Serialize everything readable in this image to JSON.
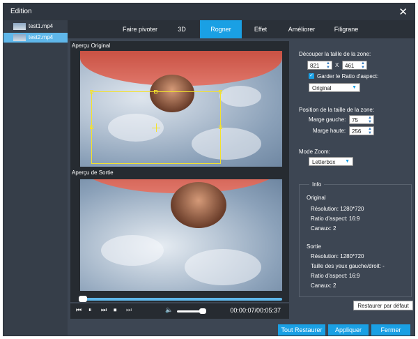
{
  "window": {
    "title": "Edition",
    "close_symbol": "✕"
  },
  "files": [
    {
      "name": "test1.mp4",
      "active": false
    },
    {
      "name": "test2.mp4",
      "active": true
    }
  ],
  "tabs": [
    "Faire pivoter",
    "3D",
    "Rogner",
    "Effet",
    "Améliorer",
    "Filigrane"
  ],
  "active_tab": "Rogner",
  "preview": {
    "original_label": "Aperçu Original",
    "output_label": "Aperçu de Sortie"
  },
  "playback": {
    "time": "00:00:07/00:05:37",
    "progress": 0.02,
    "volume": 0.8
  },
  "crop": {
    "section_label": "Découper la taille de la zone:",
    "width": "821",
    "separator": "X",
    "height": "461",
    "keep_ratio_label": "Garder le Ratio d'aspect:",
    "keep_ratio_checked": true,
    "ratio_value": "Original",
    "position_label": "Position de la taille de la zone:",
    "left_margin_label": "Marge gauche:",
    "left_margin": "75",
    "top_margin_label": "Marge haute:",
    "top_margin": "256",
    "zoom_label": "Mode Zoom:",
    "zoom_value": "Letterbox"
  },
  "info": {
    "title": "Info",
    "original_title": "Original",
    "original_resolution": "Résolution: 1280*720",
    "original_ratio": "Ratio d'aspect: 16:9",
    "original_channels": "Canaux: 2",
    "output_title": "Sortie",
    "output_resolution": "Résolution: 1280*720",
    "output_eyes": "Taille des yeux gauche/droit: -",
    "output_ratio": "Ratio d'aspect: 16:9",
    "output_channels": "Canaux: 2"
  },
  "buttons": {
    "reset_default": "Restaurer par défaut",
    "reset_all": "Tout Restaurer",
    "apply": "Appliquer",
    "close": "Fermer"
  },
  "colors": {
    "accent": "#1aa0e4",
    "crop_frame": "#f4e22c",
    "panel_bg": "#3d4653"
  }
}
